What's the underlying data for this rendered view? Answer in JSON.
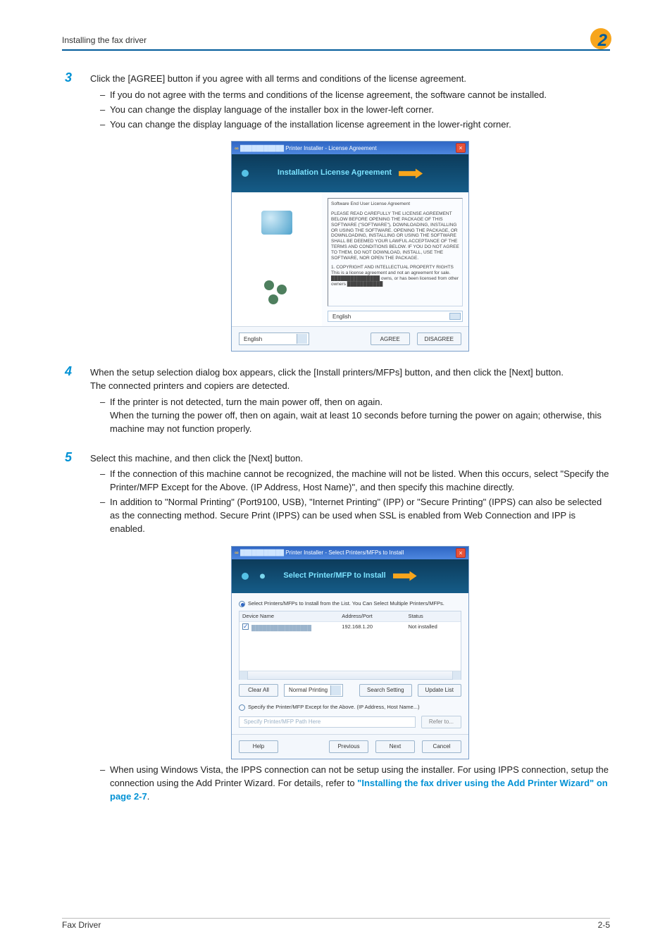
{
  "header": {
    "section": "Installing the fax driver",
    "chapter_number": "2"
  },
  "footer": {
    "left": "Fax Driver",
    "right": "2-5"
  },
  "steps": [
    {
      "num": "3",
      "lead": "Click the [AGREE] button if you agree with all terms and conditions of the license agreement.",
      "bullets": [
        "If you do not agree with the terms and conditions of the license agreement, the software cannot be installed.",
        "You can change the display language of the installer box in the lower-left corner.",
        "You can change the display language of the installation license agreement in the lower-right corner."
      ]
    },
    {
      "num": "4",
      "lead": "When the setup selection dialog box appears, click the [Install printers/MFPs] button, and then click the [Next] button.",
      "lead2": "The connected printers and copiers are detected.",
      "bullets": [
        "If the printer is not detected, turn the main power off, then on again.\nWhen the turning the power off, then on again, wait at least 10 seconds before turning the power on again; otherwise, this machine may not function properly."
      ]
    },
    {
      "num": "5",
      "lead": "Select this machine, and then click the [Next] button.",
      "bullets": [
        "If the connection of this machine cannot be recognized, the machine will not be listed. When this occurs, select \"Specify the Printer/MFP Except for the Above. (IP Address, Host Name)\", and then specify this machine directly.",
        "In addition to \"Normal Printing\" (Port9100, USB), \"Internet Printing\" (IPP) or \"Secure Printing\" (IPPS) can also be selected as the connecting method. Secure Print (IPPS) can be used when SSL is enabled from Web Connection and IPP is enabled."
      ],
      "tail_plain": "When using Windows Vista, the IPPS connection can not be setup using the installer. For using IPPS connection, setup the connection using the Add Printer Wizard. For details, refer to ",
      "tail_link": "\"Installing the fax driver using the Add Printer Wizard\" on page 2-7",
      "tail_after": "."
    }
  ],
  "dialog_license": {
    "title_suffix": "Printer Installer - License Agreement",
    "banner": "Installation License Agreement",
    "scroll_heading": "Software End User License Agreement",
    "scroll_body": "PLEASE READ CAREFULLY THE LICENSE AGREEMENT BELOW BEFORE OPENING THE PACKAGE OF THIS SOFTWARE (\"SOFTWARE\"), DOWNLOADING, INSTALLING OR USING THE SOFTWARE. OPENING THE PACKAGE, OR DOWNLOADING, INSTALLING OR USING THE SOFTWARE SHALL BE DEEMED YOUR LAWFUL ACCEPTANCE OF THE TERMS AND CONDITIONS BELOW. IF YOU DO NOT AGREE TO THEM, DO NOT DOWNLOAD, INSTALL, USE THE SOFTWARE, NOR OPEN THE PACKAGE.",
    "scroll_sec1_title": "1. COPYRIGHT AND INTELLECTUAL PROPERTY RIGHTS",
    "scroll_sec1_body": "This is a license agreement and not an agreement for sale. ███████████████ owns, or has been licensed from other owners ███████████",
    "left_caption": "",
    "lang_selector": "English",
    "footer_lang": "English",
    "btn_agree": "AGREE",
    "btn_disagree": "DISAGREE"
  },
  "dialog_select": {
    "title_suffix": "Printer Installer - Select Printers/MFPs to Install",
    "banner": "Select Printer/MFP to Install",
    "radio1": "Select Printers/MFPs to Install from the List. You Can Select Multiple Printers/MFPs.",
    "columns": {
      "c1": "Device Name",
      "c2": "Address/Port",
      "c3": "Status"
    },
    "row": {
      "c1": "████████████████",
      "c2": "192.168.1.20",
      "c3": "Not installed"
    },
    "btn_clear": "Clear All",
    "print_mode": "Normal Printing",
    "btn_search": "Search Setting",
    "btn_update": "Update List",
    "radio2": "Specify the Printer/MFP Except for the Above. (IP Address, Host Name...)",
    "path_placeholder": "Specify Printer/MFP Path Here",
    "btn_refer": "Refer to...",
    "btn_help": "Help",
    "btn_prev": "Previous",
    "btn_next": "Next",
    "btn_cancel": "Cancel"
  }
}
